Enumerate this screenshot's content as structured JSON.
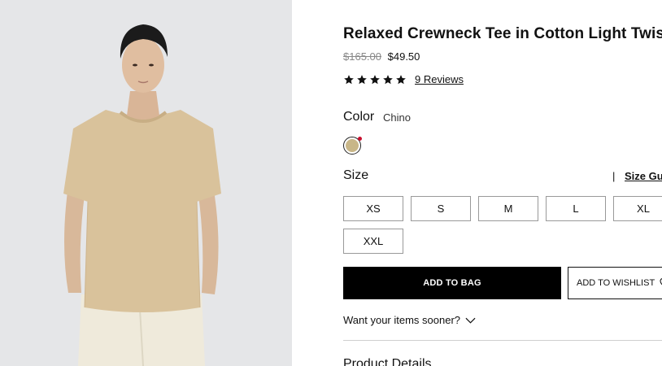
{
  "product": {
    "image_alt": "Man wearing relaxed crewneck tee in chino",
    "title": "Relaxed Crewneck Tee in Cotton Light Twist",
    "price_original": "$165.00",
    "price_sale": "$49.50",
    "rating_stars": 5,
    "reviews_label": "9 Reviews"
  },
  "color": {
    "label": "Color",
    "selected": "Chino",
    "swatch_hex": "#c8b688"
  },
  "size": {
    "label": "Size",
    "separator": "|",
    "guide_label": "Size Guide",
    "options": [
      "XS",
      "S",
      "M",
      "L",
      "XL",
      "XXL"
    ]
  },
  "actions": {
    "add_to_bag": "ADD TO BAG",
    "add_to_wishlist": "ADD TO WISHLIST"
  },
  "delivery": {
    "prompt": "Want your items sooner?"
  },
  "sections": {
    "product_details": "Product Details"
  }
}
